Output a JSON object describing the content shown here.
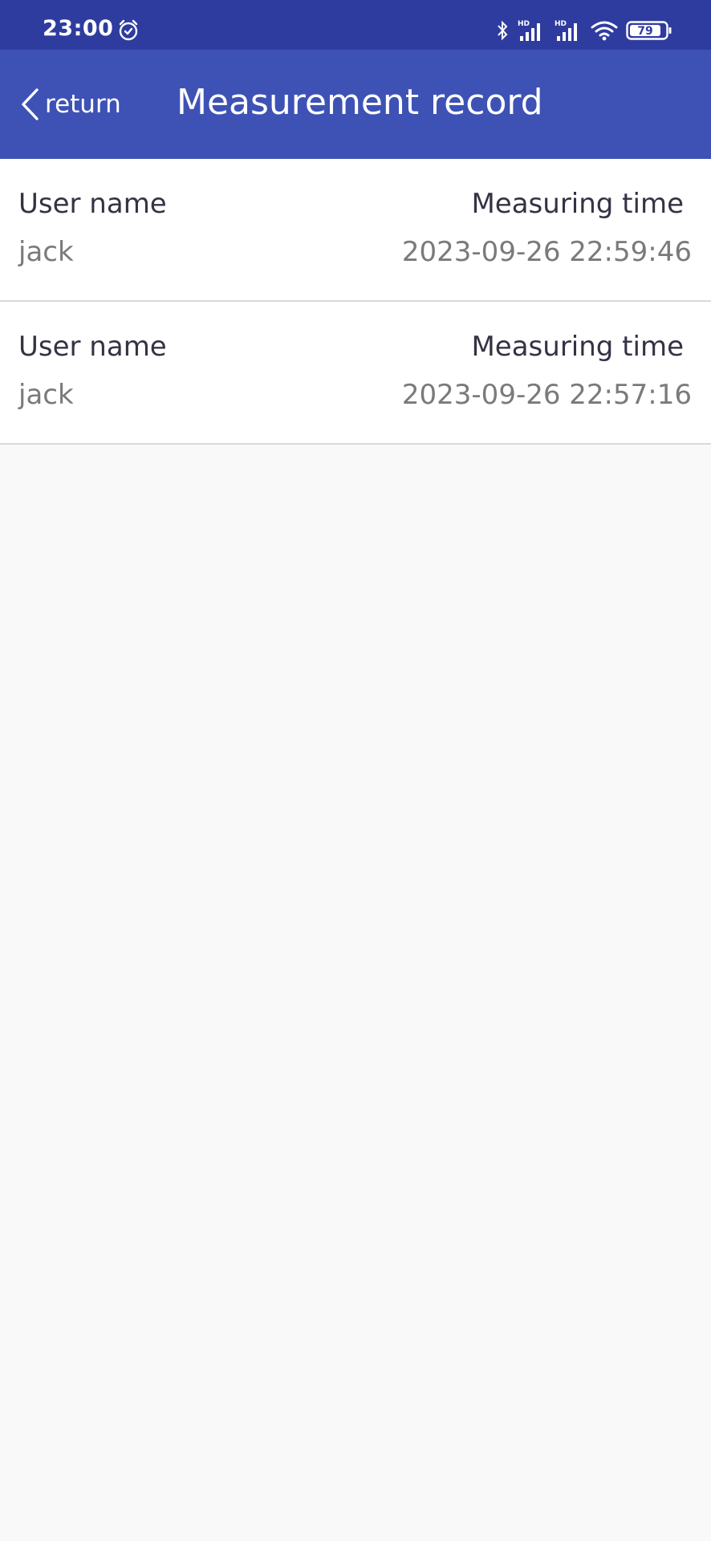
{
  "status_bar": {
    "time": "23:00",
    "battery": "79",
    "icons": [
      "alarm-icon",
      "bluetooth-icon",
      "hd-signal-icon",
      "hd-signal-icon",
      "wifi-icon",
      "battery-icon"
    ]
  },
  "header": {
    "back_label": "return",
    "title": "Measurement record",
    "background_color": "#3e52b5"
  },
  "records": [
    {
      "user_label": "User name",
      "user_value": "jack",
      "time_label": "Measuring time",
      "time_value": "2023-09-26 22:59:46"
    },
    {
      "user_label": "User name",
      "user_value": "jack",
      "time_label": "Measuring time",
      "time_value": "2023-09-26 22:57:16"
    }
  ]
}
